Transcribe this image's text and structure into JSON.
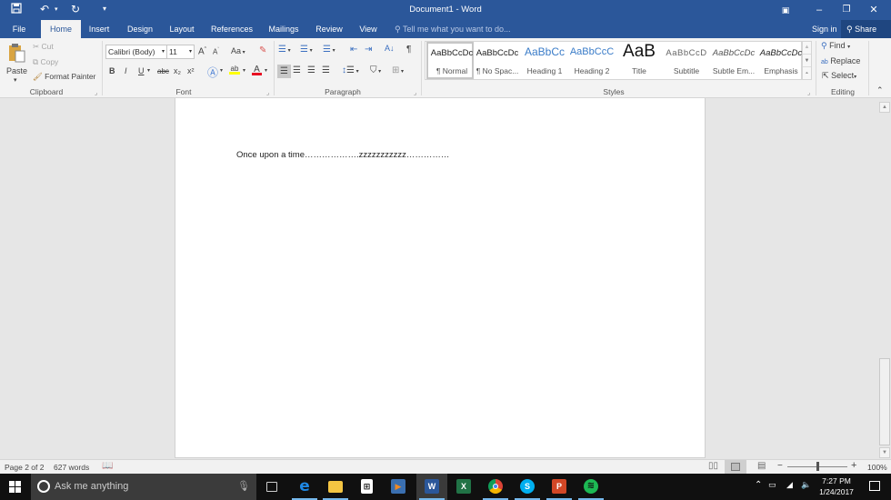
{
  "titlebar": {
    "title": "Document1 - Word",
    "quick_access": {
      "save_icon": "save-icon",
      "undo_icon": "undo-icon",
      "redo_icon": "redo-icon",
      "customize_icon": "customize-qat-icon"
    },
    "window_controls": {
      "ribbon_display": "ribbon-display-options-icon",
      "minimize": "minimize-icon",
      "restore": "restore-icon",
      "close": "close-icon"
    }
  },
  "tabs": [
    {
      "label": "File"
    },
    {
      "label": "Home",
      "active": true
    },
    {
      "label": "Insert"
    },
    {
      "label": "Design"
    },
    {
      "label": "Layout"
    },
    {
      "label": "References"
    },
    {
      "label": "Mailings"
    },
    {
      "label": "Review"
    },
    {
      "label": "View"
    }
  ],
  "tell_me": {
    "placeholder": "Tell me what you want to do..."
  },
  "account": {
    "sign_in": "Sign in",
    "share": "Share"
  },
  "ribbon": {
    "clipboard": {
      "label": "Clipboard",
      "paste": "Paste",
      "cut": "Cut",
      "copy": "Copy",
      "format_painter": "Format Painter"
    },
    "font": {
      "label": "Font",
      "font_name": "Calibri (Body)",
      "font_size": "11",
      "change_case": "Aa",
      "bold": "B",
      "italic": "I",
      "underline": "U",
      "strikethrough": "abc",
      "subscript": "x₂",
      "superscript": "x²",
      "highlight_color": "#ffff00",
      "font_color": "#e81123"
    },
    "paragraph": {
      "label": "Paragraph"
    },
    "styles": {
      "label": "Styles",
      "items": [
        {
          "preview": "AaBbCcDc",
          "name": "¶ Normal",
          "selected": true
        },
        {
          "preview": "AaBbCcDc",
          "name": "¶ No Spac..."
        },
        {
          "preview": "AaBbCc",
          "name": "Heading 1"
        },
        {
          "preview": "AaBbCcC",
          "name": "Heading 2"
        },
        {
          "preview": "AaB",
          "name": "Title"
        },
        {
          "preview": "AaBbCcD",
          "name": "Subtitle"
        },
        {
          "preview": "AaBbCcDc",
          "name": "Subtle Em..."
        },
        {
          "preview": "AaBbCcDc",
          "name": "Emphasis"
        }
      ]
    },
    "editing": {
      "label": "Editing",
      "find": "Find",
      "replace": "Replace",
      "select": "Select"
    }
  },
  "document": {
    "text": "Once upon a time……………….zzzzzzzzzzz……………"
  },
  "statusbar": {
    "page": "Page 2 of 2",
    "words": "627 words",
    "zoom": "100%",
    "zoom_fraction": 0.5
  },
  "taskbar": {
    "search_placeholder": "Ask me anything",
    "apps": [
      {
        "name": "task-view",
        "label": "Task View"
      },
      {
        "name": "edge",
        "label": "e",
        "color": "#1e88e5",
        "open": true
      },
      {
        "name": "file-explorer",
        "label": "",
        "color": "#f4c542",
        "open": true
      },
      {
        "name": "store",
        "label": "",
        "color": "#ffffff"
      },
      {
        "name": "media-player",
        "label": "",
        "color": "#f08a24"
      },
      {
        "name": "word",
        "label": "W",
        "color": "#2b579a",
        "open": true,
        "active": true
      },
      {
        "name": "excel",
        "label": "X",
        "color": "#217346"
      },
      {
        "name": "chrome",
        "label": "",
        "color": "#4caf50",
        "open": true
      },
      {
        "name": "skype",
        "label": "S",
        "color": "#00aff0",
        "open": true
      },
      {
        "name": "powerpoint",
        "label": "P",
        "color": "#d24726",
        "open": true
      },
      {
        "name": "spotify",
        "label": "",
        "color": "#1db954",
        "open": true
      }
    ],
    "time": "7:27 PM",
    "date": "1/24/2017"
  }
}
